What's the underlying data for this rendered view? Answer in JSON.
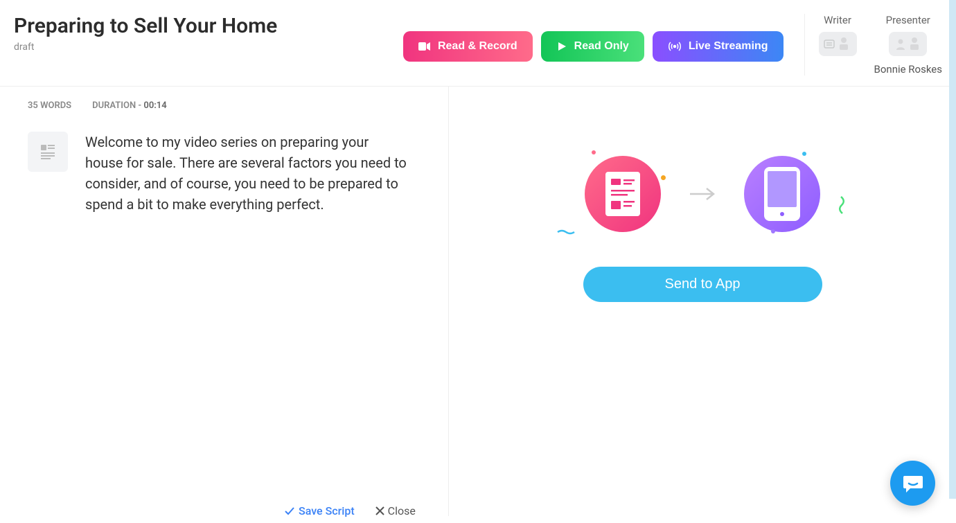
{
  "header": {
    "title": "Preparing to Sell Your Home",
    "status": "draft",
    "buttons": {
      "read_record": "Read & Record",
      "read_only": "Read Only",
      "live_streaming": "Live Streaming"
    },
    "roles": {
      "writer_label": "Writer",
      "presenter_label": "Presenter",
      "presenter_name": "Bonnie Roskes"
    }
  },
  "stats": {
    "words_label": "35 WORDS",
    "duration_label": "DURATION - ",
    "duration_value": "00:14"
  },
  "script": {
    "text": "Welcome to my video series on preparing your house for sale. There are several factors you need to consider, and of course, you need to be prepared to spend a bit to make everything perfect."
  },
  "right_panel": {
    "send_button": "Send to App"
  },
  "footer": {
    "save": "Save Script",
    "close": "Close"
  }
}
